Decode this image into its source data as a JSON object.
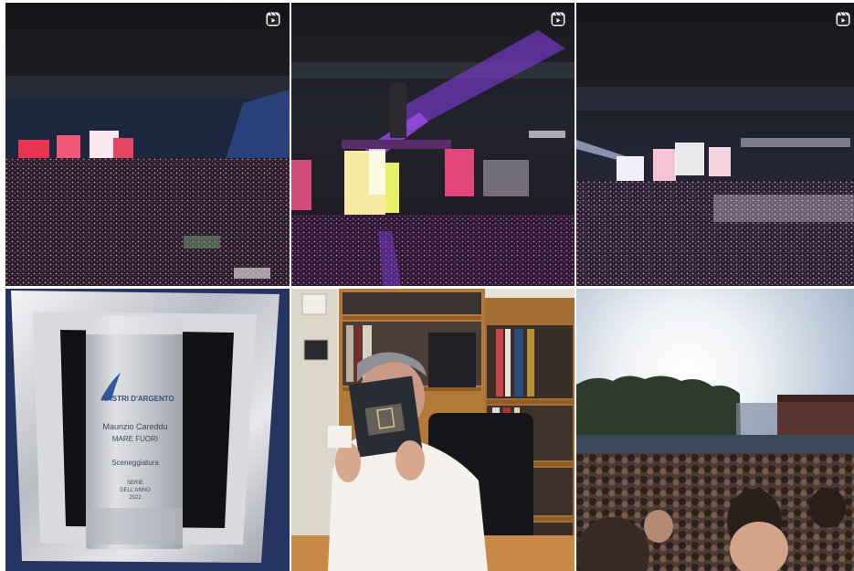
{
  "grid": {
    "columns": 3,
    "rows": 2,
    "posts": [
      {
        "index": 0,
        "type": "reel",
        "subject": "stadium concert night view with stage screens",
        "badge_icon": "reels-icon"
      },
      {
        "index": 1,
        "type": "reel",
        "subject": "concert stage with purple laser beams",
        "badge_icon": "reels-icon"
      },
      {
        "index": 2,
        "type": "reel",
        "subject": "stadium concert wide view with stage lights",
        "badge_icon": "reels-icon"
      },
      {
        "index": 3,
        "type": "image",
        "subject": "silver award plaque"
      },
      {
        "index": 4,
        "type": "image",
        "subject": "man reading a book in front of bookshelves"
      },
      {
        "index": 5,
        "type": "image",
        "subject": "crowd in front of stadium at sunset"
      }
    ]
  },
  "award": {
    "brand": "NASTRI D'ARGENTO",
    "recipient": "Maurizio Careddu",
    "title": "MARE FUORI",
    "category": "Sceneggiatura",
    "line1": "SERIE",
    "line2": "DELL'ANNO",
    "year": "2022"
  },
  "colors": {
    "background": "#ffffff",
    "badge": "#ffffff"
  }
}
